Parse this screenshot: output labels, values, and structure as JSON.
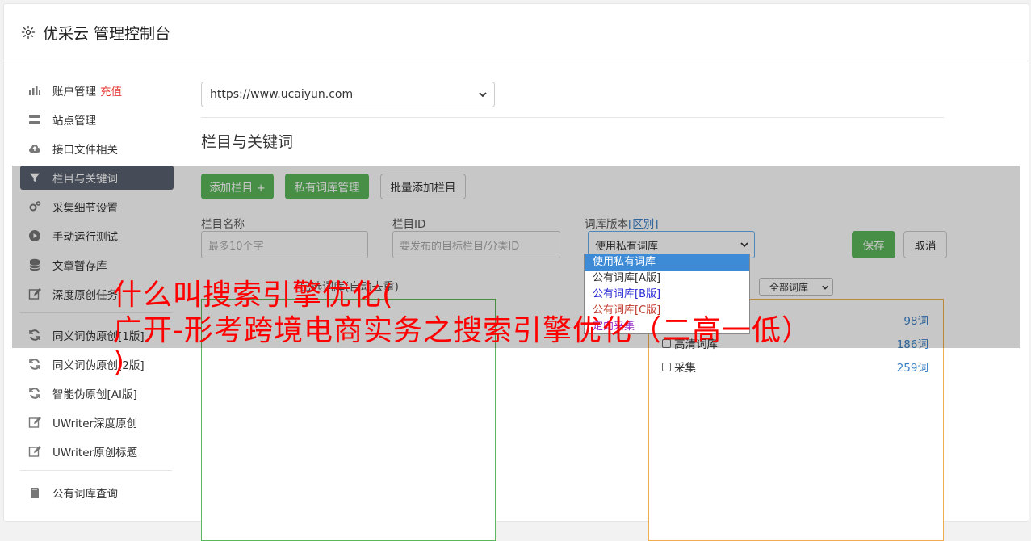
{
  "header": {
    "title": "优采云 管理控制台",
    "icon": "gear-icon"
  },
  "sidebar": {
    "items": [
      {
        "label": "账户管理",
        "badge": "充值",
        "icon": "bar-chart-icon"
      },
      {
        "label": "站点管理",
        "icon": "server-icon"
      },
      {
        "label": "接口文件相关",
        "icon": "cloud-upload-icon"
      },
      {
        "label": "栏目与关键词",
        "icon": "filter-icon",
        "active": true
      },
      {
        "label": "采集细节设置",
        "icon": "cogs-icon"
      },
      {
        "label": "手动运行测试",
        "icon": "play-circle-icon"
      },
      {
        "label": "文章暂存库",
        "icon": "database-icon"
      },
      {
        "label": "深度原创任务",
        "icon": "edit-icon"
      },
      {
        "label": "同义词伪原创[1版]",
        "icon": "refresh-icon"
      },
      {
        "label": "同义词伪原创[2版]",
        "icon": "refresh-icon"
      },
      {
        "label": "智能伪原创[AI版]",
        "icon": "refresh-icon"
      },
      {
        "label": "UWriter深度原创",
        "icon": "edit-icon"
      },
      {
        "label": "UWriter原创标题",
        "icon": "edit-icon"
      },
      {
        "label": "公有词库查询",
        "icon": "book-icon"
      }
    ]
  },
  "main": {
    "site_select": "https://www.ucaiyun.com",
    "section_title": "栏目与关键词",
    "buttons": {
      "add_column": "添加栏目 +",
      "private_lib": "私有词库管理",
      "batch_add": "批量添加栏目",
      "save": "保存",
      "cancel": "取消"
    },
    "fields": {
      "name_label": "栏目名称",
      "name_placeholder": "最多10个字",
      "id_label": "栏目ID",
      "id_placeholder": "要发布的目标栏目/分类ID",
      "version_label": "词库版本",
      "version_link": "[区别]",
      "version_value": "使用私有词库"
    },
    "dropdown_options": [
      "使用私有词库",
      "公有词库[A版]",
      "公有词库[B版]",
      "公有词库[C版]",
      "定向采集"
    ],
    "left_panel_caption": "已选词库(自动去重)",
    "filter_value": "全部词库",
    "libraries": [
      {
        "name": "",
        "count": "98词"
      },
      {
        "name": "高清词库",
        "count": "186词"
      },
      {
        "name": "采集",
        "count": "259词"
      }
    ]
  },
  "overlay": {
    "headline_1": "什么叫搜索引擎优化(",
    "headline_2": "广开-形考跨境电商实务之搜索引擎优化（二高一低）",
    "headline_3": ")"
  },
  "colors": {
    "green": "#5cb85c",
    "active_nav": "#5a6270",
    "headline": "#ff0000",
    "badge": "#e53935"
  }
}
